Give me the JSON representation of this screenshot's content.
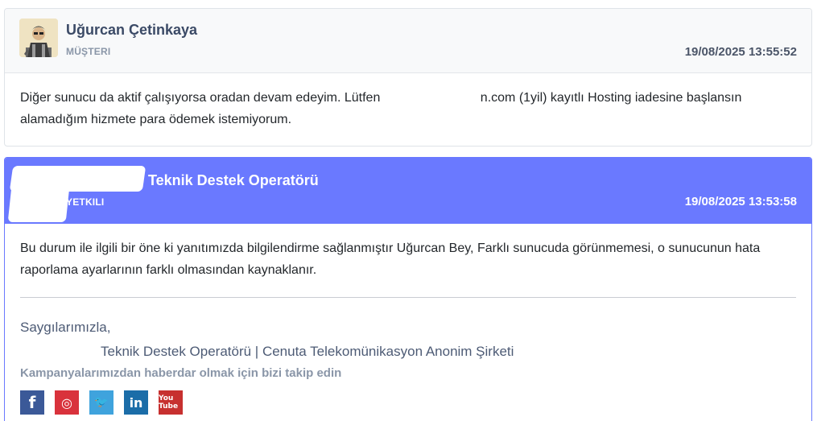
{
  "client_message": {
    "author": "Uğurcan Çetinkaya",
    "role": "MÜŞTERI",
    "timestamp": "19/08/2025 13:55:52",
    "body_before": "Diğer sunucu da aktif çalışıyorsa oradan devam edeyim. Lütfen ",
    "body_after": "n.com (1yil) kayıtlı Hosting iadesine başlansın alamadığım hizmete para ödemek istemiyorum."
  },
  "staff_message": {
    "author": "- Teknik Destek Operatörü",
    "role": "YETKILI",
    "timestamp": "19/08/2025 13:53:58",
    "accent_color": "#6a79ff",
    "body": "Bu durum ile ilgili bir öne ki yanıtımızda bilgilendirme sağlanmıştır Uğurcan Bey, Farklı sunucuda görünmemesi, o sunucunun hata raporlama ayarlarının farklı olmasından kaynaklanır.",
    "signature": {
      "greeting": "Saygılarımızla,",
      "title": "Teknik Destek Operatörü | Cenuta Telekomünikasyon Anonim Şirketi",
      "follow_text": "Kampanyalarımızdan haberdar olmak için bizi takip edin",
      "social": [
        {
          "name": "facebook-icon",
          "glyph": "f"
        },
        {
          "name": "instagram-icon",
          "glyph": "◎"
        },
        {
          "name": "twitter-icon",
          "glyph": "🐦"
        },
        {
          "name": "linkedin-icon",
          "glyph": "in"
        },
        {
          "name": "youtube-icon",
          "glyph": "You Tube"
        }
      ]
    }
  }
}
